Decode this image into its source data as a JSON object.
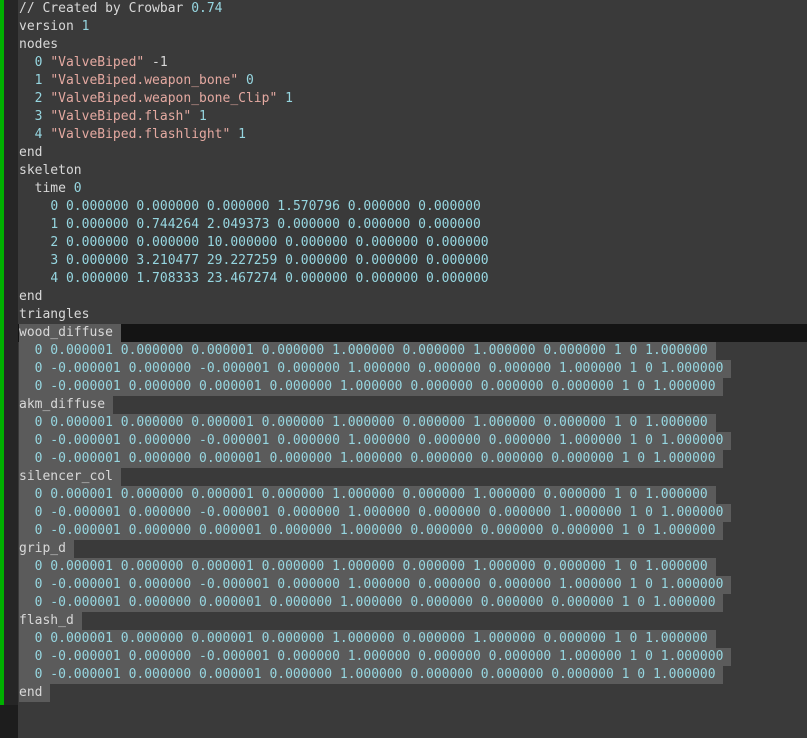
{
  "editor": {
    "lines": [
      {
        "indent": "",
        "tokens": [
          {
            "t": "// Created by Crowbar ",
            "c": "comment"
          },
          {
            "t": "0.74",
            "c": "num"
          }
        ]
      },
      {
        "indent": "",
        "tokens": [
          {
            "t": "version ",
            "c": "default"
          },
          {
            "t": "1",
            "c": "num"
          }
        ]
      },
      {
        "indent": "",
        "tokens": [
          {
            "t": "nodes",
            "c": "default"
          }
        ]
      },
      {
        "indent": "  ",
        "tokens": [
          {
            "t": "0 ",
            "c": "num"
          },
          {
            "t": "\"ValveBiped\"",
            "c": "str"
          },
          {
            "t": " -1",
            "c": "default"
          }
        ]
      },
      {
        "indent": "  ",
        "tokens": [
          {
            "t": "1 ",
            "c": "num"
          },
          {
            "t": "\"ValveBiped.weapon_bone\"",
            "c": "str"
          },
          {
            "t": " 0",
            "c": "num"
          }
        ]
      },
      {
        "indent": "  ",
        "tokens": [
          {
            "t": "2 ",
            "c": "num"
          },
          {
            "t": "\"ValveBiped.weapon_bone_Clip\"",
            "c": "str"
          },
          {
            "t": " 1",
            "c": "num"
          }
        ]
      },
      {
        "indent": "  ",
        "tokens": [
          {
            "t": "3 ",
            "c": "num"
          },
          {
            "t": "\"ValveBiped.flash\"",
            "c": "str"
          },
          {
            "t": " 1",
            "c": "num"
          }
        ]
      },
      {
        "indent": "  ",
        "tokens": [
          {
            "t": "4 ",
            "c": "num"
          },
          {
            "t": "\"ValveBiped.flashlight\"",
            "c": "str"
          },
          {
            "t": " 1",
            "c": "num"
          }
        ]
      },
      {
        "indent": "",
        "tokens": [
          {
            "t": "end",
            "c": "default"
          }
        ]
      },
      {
        "indent": "",
        "tokens": [
          {
            "t": "skeleton",
            "c": "default"
          }
        ]
      },
      {
        "indent": "  ",
        "tokens": [
          {
            "t": "time ",
            "c": "default"
          },
          {
            "t": "0",
            "c": "num"
          }
        ]
      },
      {
        "indent": "    ",
        "tokens": [
          {
            "t": "0 0.000000 0.000000 0.000000 1.570796 0.000000 0.000000",
            "c": "num"
          }
        ]
      },
      {
        "indent": "    ",
        "tokens": [
          {
            "t": "1 0.000000 0.744264 2.049373 0.000000 0.000000 0.000000",
            "c": "num"
          }
        ]
      },
      {
        "indent": "    ",
        "tokens": [
          {
            "t": "2 0.000000 0.000000 10.000000 0.000000 0.000000 0.000000",
            "c": "num"
          }
        ]
      },
      {
        "indent": "    ",
        "tokens": [
          {
            "t": "3 0.000000 3.210477 29.227259 0.000000 0.000000 0.000000",
            "c": "num"
          }
        ]
      },
      {
        "indent": "    ",
        "tokens": [
          {
            "t": "4 0.000000 1.708333 23.467274 0.000000 0.000000 0.000000",
            "c": "num"
          }
        ]
      },
      {
        "indent": "",
        "tokens": [
          {
            "t": "end",
            "c": "default"
          }
        ]
      },
      {
        "indent": "",
        "tokens": [
          {
            "t": "triangles",
            "c": "default"
          }
        ]
      },
      {
        "indent": "",
        "selected": true,
        "tokens": [
          {
            "t": "wood_diffuse",
            "c": "default"
          }
        ]
      },
      {
        "indent": "  ",
        "selected": true,
        "tokens": [
          {
            "t": "0 0.000001 0.000000 0.000001 0.000000 1.000000 0.000000 1.000000 0.000000 1 0 1.000000",
            "c": "num"
          }
        ]
      },
      {
        "indent": "  ",
        "selected": true,
        "tokens": [
          {
            "t": "0 -0.000001 0.000000 -0.000001 0.000000 1.000000 0.000000 0.000000 1.000000 1 0 1.000000",
            "c": "num"
          }
        ]
      },
      {
        "indent": "  ",
        "selected": true,
        "tokens": [
          {
            "t": "0 -0.000001 0.000000 0.000001 0.000000 1.000000 0.000000 0.000000 0.000000 1 0 1.000000",
            "c": "num"
          }
        ]
      },
      {
        "indent": "",
        "selected": true,
        "tokens": [
          {
            "t": "akm_diffuse",
            "c": "default"
          }
        ]
      },
      {
        "indent": "  ",
        "selected": true,
        "tokens": [
          {
            "t": "0 0.000001 0.000000 0.000001 0.000000 1.000000 0.000000 1.000000 0.000000 1 0 1.000000",
            "c": "num"
          }
        ]
      },
      {
        "indent": "  ",
        "selected": true,
        "tokens": [
          {
            "t": "0 -0.000001 0.000000 -0.000001 0.000000 1.000000 0.000000 0.000000 1.000000 1 0 1.000000",
            "c": "num"
          }
        ]
      },
      {
        "indent": "  ",
        "selected": true,
        "tokens": [
          {
            "t": "0 -0.000001 0.000000 0.000001 0.000000 1.000000 0.000000 0.000000 0.000000 1 0 1.000000",
            "c": "num"
          }
        ]
      },
      {
        "indent": "",
        "selected": true,
        "tokens": [
          {
            "t": "silencer_col",
            "c": "default"
          }
        ]
      },
      {
        "indent": "  ",
        "selected": true,
        "tokens": [
          {
            "t": "0 0.000001 0.000000 0.000001 0.000000 1.000000 0.000000 1.000000 0.000000 1 0 1.000000",
            "c": "num"
          }
        ]
      },
      {
        "indent": "  ",
        "selected": true,
        "tokens": [
          {
            "t": "0 -0.000001 0.000000 -0.000001 0.000000 1.000000 0.000000 0.000000 1.000000 1 0 1.000000",
            "c": "num"
          }
        ]
      },
      {
        "indent": "  ",
        "selected": true,
        "tokens": [
          {
            "t": "0 -0.000001 0.000000 0.000001 0.000000 1.000000 0.000000 0.000000 0.000000 1 0 1.000000",
            "c": "num"
          }
        ]
      },
      {
        "indent": "",
        "selected": true,
        "tokens": [
          {
            "t": "grip_d",
            "c": "default"
          }
        ]
      },
      {
        "indent": "  ",
        "selected": true,
        "tokens": [
          {
            "t": "0 0.000001 0.000000 0.000001 0.000000 1.000000 0.000000 1.000000 0.000000 1 0 1.000000",
            "c": "num"
          }
        ]
      },
      {
        "indent": "  ",
        "selected": true,
        "tokens": [
          {
            "t": "0 -0.000001 0.000000 -0.000001 0.000000 1.000000 0.000000 0.000000 1.000000 1 0 1.000000",
            "c": "num"
          }
        ]
      },
      {
        "indent": "  ",
        "selected": true,
        "tokens": [
          {
            "t": "0 -0.000001 0.000000 0.000001 0.000000 1.000000 0.000000 0.000000 0.000000 1 0 1.000000",
            "c": "num"
          }
        ]
      },
      {
        "indent": "",
        "selected": true,
        "tokens": [
          {
            "t": "flash_d",
            "c": "default"
          }
        ]
      },
      {
        "indent": "  ",
        "selected": true,
        "tokens": [
          {
            "t": "0 0.000001 0.000000 0.000001 0.000000 1.000000 0.000000 1.000000 0.000000 1 0 1.000000",
            "c": "num"
          }
        ]
      },
      {
        "indent": "  ",
        "selected": true,
        "tokens": [
          {
            "t": "0 -0.000001 0.000000 -0.000001 0.000000 1.000000 0.000000 0.000000 1.000000 1 0 1.000000",
            "c": "num"
          }
        ]
      },
      {
        "indent": "  ",
        "selected": true,
        "tokens": [
          {
            "t": "0 -0.000001 0.000000 0.000001 0.000000 1.000000 0.000000 0.000000 0.000000 1 0 1.000000",
            "c": "num"
          }
        ]
      },
      {
        "indent": "",
        "selected": true,
        "tokens": [
          {
            "t": "end",
            "c": "default"
          }
        ]
      }
    ]
  }
}
